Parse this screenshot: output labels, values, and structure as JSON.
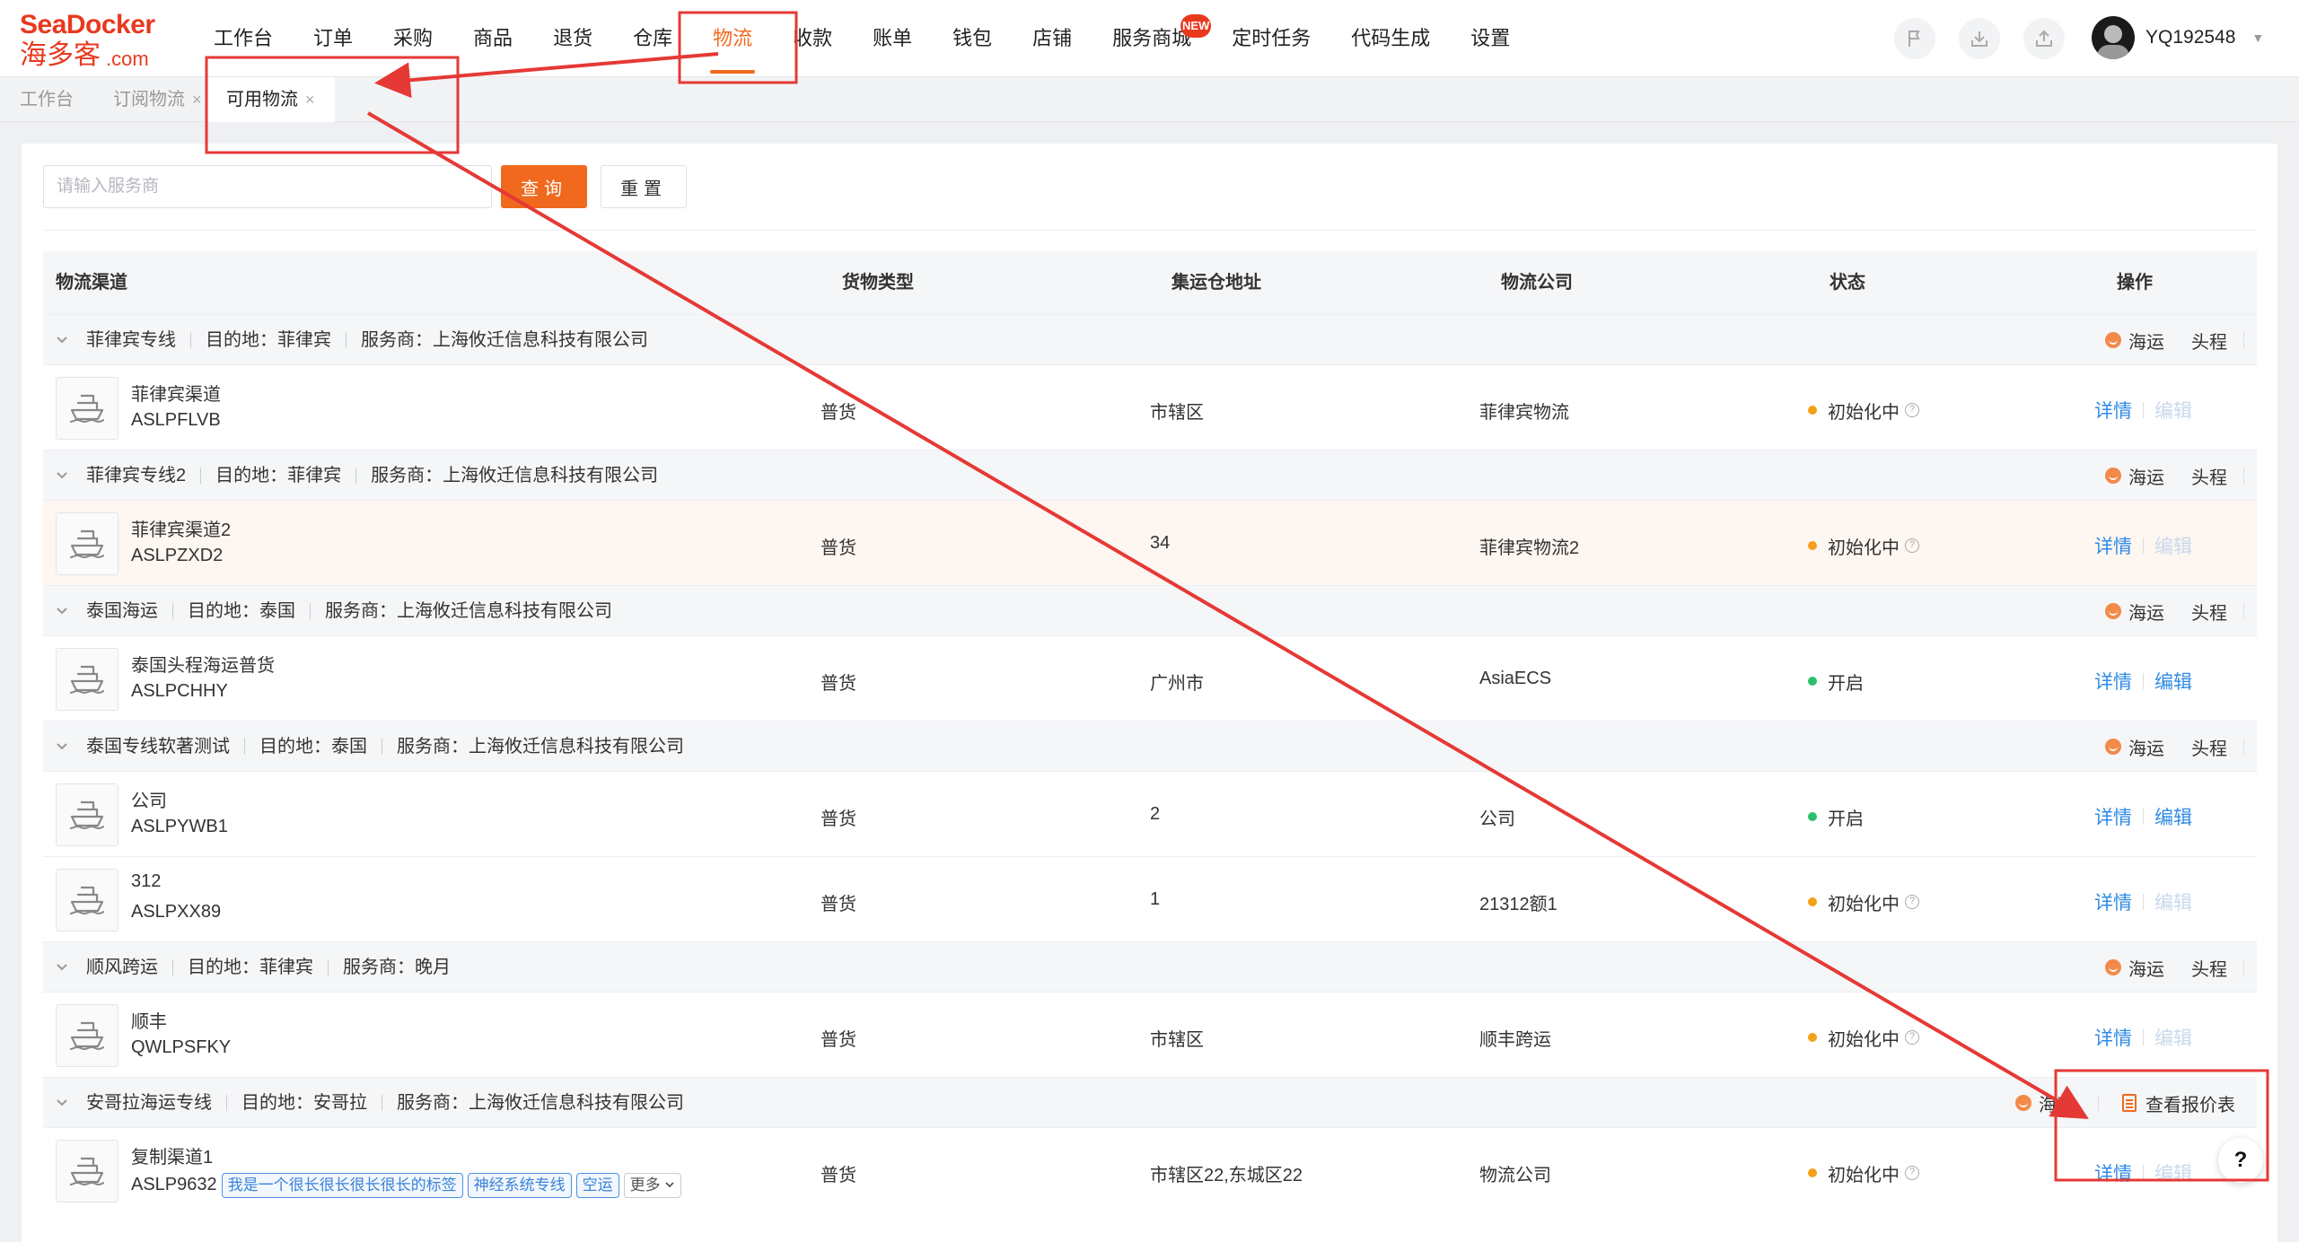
{
  "brand": {
    "logo_top": "SeaDocker",
    "logo_cn": "海多客",
    "logo_com": ".com"
  },
  "nav": {
    "items": [
      "工作台",
      "订单",
      "采购",
      "商品",
      "退货",
      "仓库",
      "物流",
      "收款",
      "账单",
      "钱包",
      "店铺",
      "服务商城",
      "定时任务",
      "代码生成",
      "设置"
    ],
    "active": "物流",
    "badge": "NEW"
  },
  "top_icons": [
    "flag-icon",
    "download-icon",
    "upload-icon"
  ],
  "user": {
    "name": "YQ192548"
  },
  "tabs": [
    {
      "label": "工作台",
      "closable": false
    },
    {
      "label": "订阅物流",
      "closable": true
    },
    {
      "label": "可用物流",
      "closable": true
    }
  ],
  "close_glyph": "×",
  "search": {
    "placeholder": "请输入服务商",
    "value": ""
  },
  "buttons": {
    "query": "查询",
    "reset": "重置"
  },
  "table": {
    "columns": [
      "物流渠道",
      "货物类型",
      "集运仓地址",
      "物流公司",
      "状态",
      "操作"
    ],
    "dest_label": "目的地：",
    "provider_label": "服务商：",
    "sea_label": "海运",
    "head_label": "头程",
    "quote_label": "查看报价表",
    "detail_label": "详情",
    "edit_label": "编辑",
    "more_label": "更多",
    "groups": [
      {
        "name": "菲律宾专线",
        "dest": "菲律宾",
        "provider": "上海攸迁信息科技有限公司",
        "show_head": true,
        "rows": [
          {
            "name": "菲律宾渠道",
            "code": "ASLPFLVB",
            "cargo": "普货",
            "address": "市辖区",
            "company": "菲律宾物流",
            "status": "初始化中",
            "status_color": "orange",
            "edit_enabled": false
          }
        ]
      },
      {
        "name": "菲律宾专线2",
        "dest": "菲律宾",
        "provider": "上海攸迁信息科技有限公司",
        "show_head": true,
        "rows": [
          {
            "name": "菲律宾渠道2",
            "code": "ASLPZXD2",
            "cargo": "普货",
            "address": "34",
            "company": "菲律宾物流2",
            "status": "初始化中",
            "status_color": "orange",
            "edit_enabled": false,
            "highlight": true
          }
        ]
      },
      {
        "name": "泰国海运",
        "dest": "泰国",
        "provider": "上海攸迁信息科技有限公司",
        "show_head": true,
        "rows": [
          {
            "name": "泰国头程海运普货",
            "code": "ASLPCHHY",
            "cargo": "普货",
            "address": "广州市",
            "company": "AsiaECS",
            "status": "开启",
            "status_color": "green",
            "edit_enabled": true
          }
        ]
      },
      {
        "name": "泰国专线软著测试",
        "dest": "泰国",
        "provider": "上海攸迁信息科技有限公司",
        "show_head": true,
        "rows": [
          {
            "name": "公司",
            "code": "ASLPYWB1",
            "cargo": "普货",
            "address": "2",
            "company": "公司",
            "status": "开启",
            "status_color": "green",
            "edit_enabled": true
          },
          {
            "name": "312",
            "code": "ASLPXX89",
            "cargo": "普货",
            "address": "1",
            "company": "21312额1",
            "status": "初始化中",
            "status_color": "orange",
            "edit_enabled": false
          }
        ]
      },
      {
        "name": "顺风跨运",
        "dest": "菲律宾",
        "provider": "晚月",
        "show_head": true,
        "rows": [
          {
            "name": "顺丰",
            "code": "QWLPSFKY",
            "cargo": "普货",
            "address": "市辖区",
            "company": "顺丰跨运",
            "status": "初始化中",
            "status_color": "orange",
            "edit_enabled": false
          }
        ]
      },
      {
        "name": "安哥拉海运专线",
        "dest": "安哥拉",
        "provider": "上海攸迁信息科技有限公司",
        "show_head": false,
        "show_quote": true,
        "rows": [
          {
            "name": "复制渠道1",
            "code": "ASLP9632",
            "tags": [
              "我是一个很长很长很长很长的标签",
              "神经系统专线",
              "空运"
            ],
            "cargo": "普货",
            "address": "市辖区22,东城区22",
            "company": "物流公司",
            "status": "初始化中",
            "status_color": "orange",
            "edit_enabled": false
          }
        ]
      }
    ]
  },
  "help_label": "?",
  "colors": {
    "accent": "#f0691e",
    "link": "#2f8be6",
    "annotation": "#e53935"
  }
}
